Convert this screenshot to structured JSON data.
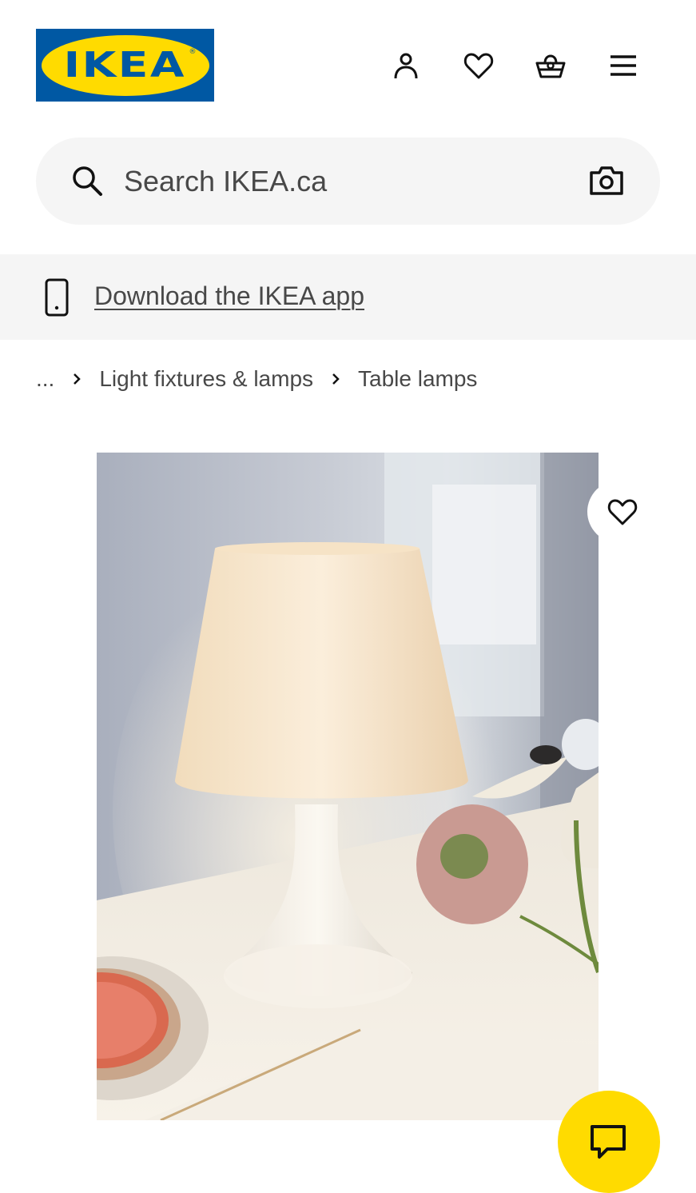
{
  "header": {
    "logo_text": "IKEA",
    "icons": [
      "account-icon",
      "heart-icon",
      "basket-icon",
      "menu-icon"
    ]
  },
  "search": {
    "placeholder": "Search IKEA.ca",
    "icons": [
      "search-icon",
      "camera-icon"
    ]
  },
  "app_banner": {
    "link_text": "Download the IKEA app",
    "icon": "phone-icon"
  },
  "breadcrumb": {
    "items": [
      "...",
      "Light fixtures & lamps",
      "Table lamps"
    ]
  },
  "product": {
    "favorite_icon": "heart-icon"
  },
  "chat": {
    "icon": "chat-icon"
  },
  "colors": {
    "brand_blue": "#0058a3",
    "brand_yellow": "#ffdb00",
    "surface_gray": "#f5f5f5",
    "text_secondary": "#484848"
  }
}
